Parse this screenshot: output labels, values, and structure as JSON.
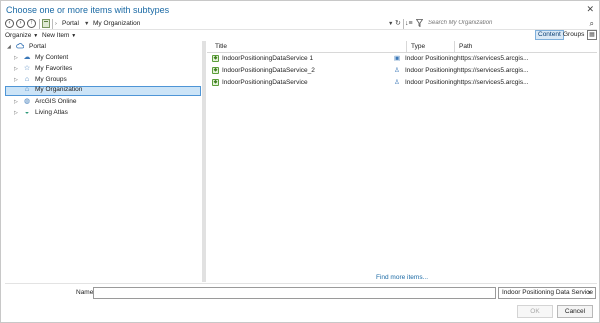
{
  "window": {
    "title": "Choose one or more items with subtypes",
    "close": "✕"
  },
  "toolbar": {
    "back": "‹",
    "forward": "›",
    "up": "↑",
    "folder_icon": "folder-icon",
    "crumbs": [
      "Portal",
      "My Organization"
    ],
    "refresh": "↻",
    "sort": "↓≡",
    "filter_icon": "filter-icon",
    "search_placeholder": "Search My Organization",
    "search_icon": "⌕"
  },
  "toolbar2": {
    "organize": "Organize",
    "new_item": "New Item",
    "tabs": [
      "Content",
      "Groups"
    ],
    "active_tab": "Content"
  },
  "tree": {
    "root": "Portal",
    "items": [
      {
        "label": "My Content",
        "icon": "cloud-icon"
      },
      {
        "label": "My Favorites",
        "icon": "star-icon"
      },
      {
        "label": "My Groups",
        "icon": "group-icon"
      },
      {
        "label": "My Organization",
        "icon": "organization-icon",
        "selected": true
      },
      {
        "label": "ArcGIS Online",
        "icon": "globe-icon"
      },
      {
        "label": "Living Atlas",
        "icon": "atlas-icon"
      }
    ]
  },
  "list": {
    "columns": [
      "Title",
      "Type",
      "Path"
    ],
    "rows": [
      {
        "title": "IndoorPositioningDataService 1",
        "type": "Indoor Positioning",
        "path": "https://services5.arcgis..."
      },
      {
        "title": "IndoorPositioningDataService_2",
        "type": "Indoor Positioning",
        "path": "https://services5.arcgis..."
      },
      {
        "title": "IndoorPositioningDataService",
        "type": "Indoor Positioning",
        "path": "https://services5.arcgis..."
      }
    ],
    "find_more": "Find more items..."
  },
  "footer": {
    "name_label": "Name",
    "name_value": "",
    "type_filter": "Indoor Positioning Data Service",
    "ok": "OK",
    "cancel": "Cancel"
  }
}
